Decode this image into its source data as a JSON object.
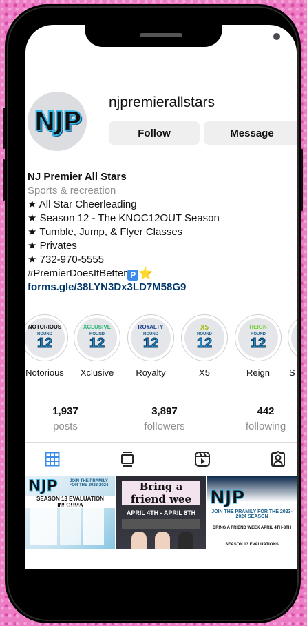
{
  "profile": {
    "avatar_text": "NJP",
    "username": "njpremierallstars",
    "follow_label": "Follow",
    "message_label": "Message"
  },
  "bio": {
    "name": "NJ Premier All Stars",
    "category": "Sports & recreation",
    "line1": "★ All Star Cheerleading",
    "line2": "★ Season 12 - The KNOC12OUT Season",
    "line3": "★ Tumble, Jump, & Flyer Classes",
    "line4": "★ Privates",
    "line5": "★ 732-970-5555",
    "hashtag": "#PremierDoesItBetter",
    "emoji_p": "P",
    "emoji_star": "⭐",
    "link": "forms.gle/38LYN3Dx3LD7M58G9"
  },
  "highlights": [
    {
      "label": "Notorious",
      "cover_title": "NOTORIOUS",
      "title_color": "#111111"
    },
    {
      "label": "Xclusive",
      "cover_title": "XCLUSIVE",
      "title_color": "#2bb673"
    },
    {
      "label": "Royalty",
      "cover_title": "ROYALTY",
      "title_color": "#1b3f8a"
    },
    {
      "label": "X5",
      "cover_title": "X5",
      "title_color": "#c8e600"
    },
    {
      "label": "Reign",
      "cover_title": "REIGN",
      "title_color": "#7ad13a"
    },
    {
      "label": "S",
      "cover_title": "",
      "title_color": "#111111"
    }
  ],
  "highlight_cover": {
    "round_text": "ROUND",
    "number_text": "12"
  },
  "stats": {
    "posts_count": "1,937",
    "posts_label": "posts",
    "followers_count": "3,897",
    "followers_label": "followers",
    "following_count": "442",
    "following_label": "following"
  },
  "posts": [
    {
      "title": "NJP",
      "caption": "JOIN THE PRAMILY FOR THE 2023-2024",
      "sub": "SEASON 13 EVALUATION INFORMA"
    },
    {
      "title": "Bring a friend wee",
      "caption": "APRIL 4TH - APRIL 8TH"
    },
    {
      "title": "NJP",
      "caption": "JOIN THE PRAMILY FOR THE 2023-2024 SEASON",
      "sub": "BRING A FRIEND WEEK APRIL 4TH-8TH",
      "footer": "SEASON 13 EVALUATIONS"
    }
  ],
  "colors": {
    "accent_blue": "#3b8ce8",
    "link": "#00376b",
    "muted": "#8e8e8e"
  }
}
